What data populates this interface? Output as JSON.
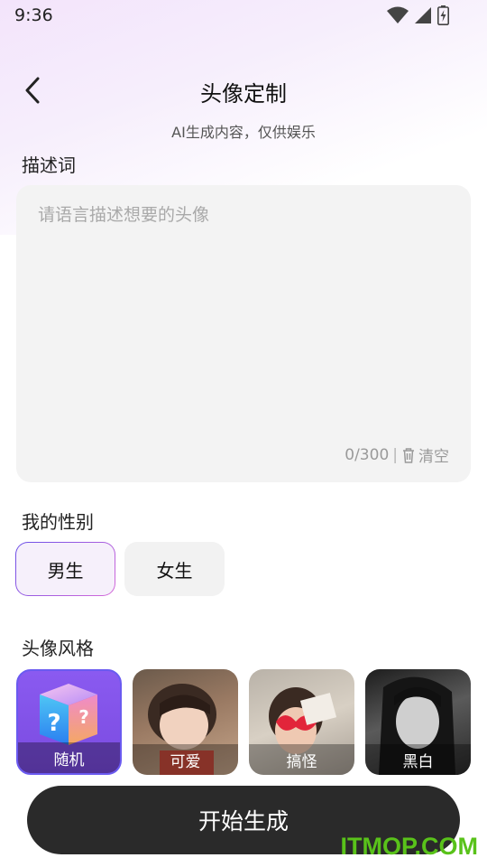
{
  "status_bar": {
    "time": "9:36",
    "icons": [
      "wifi-icon",
      "signal-icon",
      "battery-charging-icon"
    ]
  },
  "header": {
    "back_icon": "chevron-left-icon",
    "title": "头像定制",
    "subtitle": "AI生成内容，仅供娱乐"
  },
  "description": {
    "label": "描述词",
    "placeholder": "请语言描述想要的头像",
    "value": "",
    "counter": "0/300",
    "separator": "|",
    "clear_label": "清空",
    "clear_icon": "trash-icon"
  },
  "gender": {
    "label": "我的性别",
    "options": [
      "男生",
      "女生"
    ],
    "selected": "男生"
  },
  "style": {
    "label": "头像风格",
    "options": [
      {
        "label": "随机",
        "icon": "mystery-box-icon"
      },
      {
        "label": "可爱",
        "icon": "cute-photo"
      },
      {
        "label": "搞怪",
        "icon": "funny-photo"
      },
      {
        "label": "黑白",
        "icon": "black-white-photo"
      }
    ],
    "selected": "随机"
  },
  "actions": {
    "start_label": "开始生成"
  },
  "watermark": {
    "text": "ITMOP.COM"
  },
  "colors": {
    "accent": "#6a50e8",
    "button_dark": "#2a2a2a",
    "watermark": "#59c21a"
  }
}
